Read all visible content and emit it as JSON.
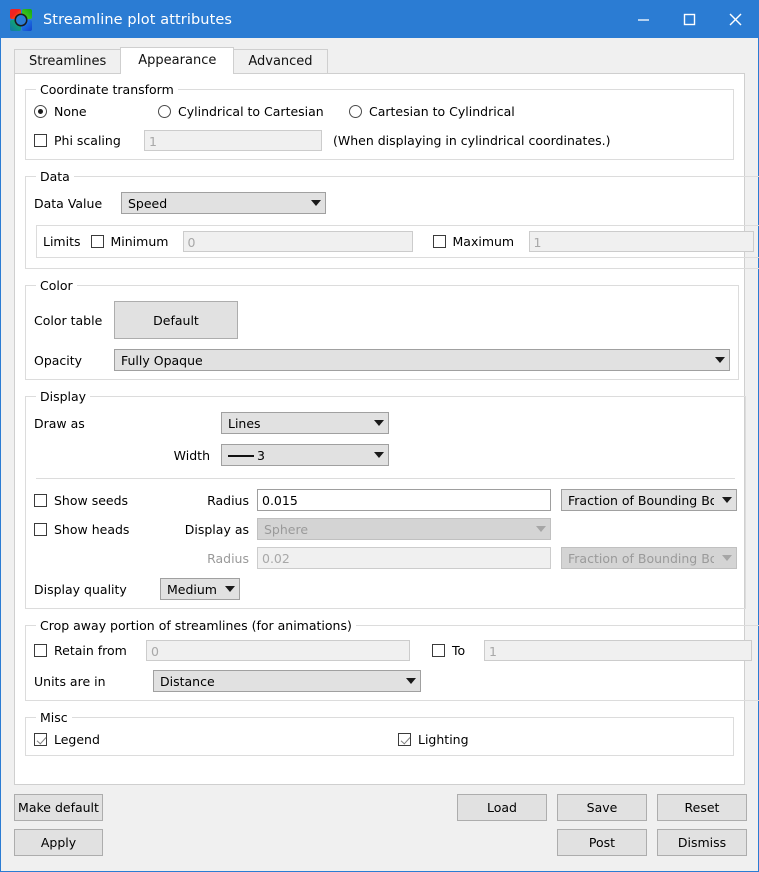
{
  "window": {
    "title": "Streamline plot attributes",
    "icon": "visit-logo-icon",
    "minimize": "minimize-icon",
    "maximize": "maximize-icon",
    "close": "close-icon",
    "titlebar_color": "#2b7cd3"
  },
  "tabs": [
    {
      "label": "Streamlines",
      "active": false
    },
    {
      "label": "Appearance",
      "active": true
    },
    {
      "label": "Advanced",
      "active": false
    }
  ],
  "coordinate_transform": {
    "legend": "Coordinate transform",
    "options": [
      {
        "label": "None",
        "selected": true
      },
      {
        "label": "Cylindrical to Cartesian",
        "selected": false
      },
      {
        "label": "Cartesian to Cylindrical",
        "selected": false
      }
    ],
    "phi_scaling": {
      "label": "Phi scaling",
      "checked": false,
      "value": "1",
      "enabled": false
    },
    "note": "(When displaying in cylindrical coordinates.)"
  },
  "data": {
    "legend": "Data",
    "data_value_label": "Data Value",
    "data_value": "Speed",
    "limits_label": "Limits",
    "minimum": {
      "label": "Minimum",
      "checked": false,
      "value": "0",
      "enabled": false
    },
    "maximum": {
      "label": "Maximum",
      "checked": false,
      "value": "1",
      "enabled": false
    }
  },
  "color": {
    "legend": "Color",
    "color_table_label": "Color table",
    "color_table": "Default",
    "opacity_label": "Opacity",
    "opacity": "Fully Opaque"
  },
  "display": {
    "legend": "Display",
    "draw_as_label": "Draw as",
    "draw_as": "Lines",
    "width_label": "Width",
    "width": "3",
    "show_seeds": {
      "label": "Show seeds",
      "checked": false
    },
    "seed_radius_label": "Radius",
    "seed_radius": "0.015",
    "seed_radius_units": "Fraction of Bounding Box",
    "show_heads": {
      "label": "Show heads",
      "checked": false
    },
    "display_as_label": "Display as",
    "display_as": "Sphere",
    "head_radius_label": "Radius",
    "head_radius": "0.02",
    "head_radius_units": "Fraction of Bounding Box",
    "display_quality_label": "Display quality",
    "display_quality": "Medium"
  },
  "crop": {
    "legend": "Crop away portion of streamlines (for animations)",
    "retain_from": {
      "label": "Retain from",
      "checked": false,
      "value": "0",
      "enabled": false
    },
    "to": {
      "label": "To",
      "checked": false,
      "value": "1",
      "enabled": false
    },
    "units_label": "Units are in",
    "units": "Distance"
  },
  "misc": {
    "legend": "Misc",
    "legend_cb": {
      "label": "Legend",
      "checked": true
    },
    "lighting_cb": {
      "label": "Lighting",
      "checked": true
    }
  },
  "buttons": {
    "make_default": "Make default",
    "apply": "Apply",
    "load": "Load",
    "save": "Save",
    "reset": "Reset",
    "post": "Post",
    "dismiss": "Dismiss"
  }
}
